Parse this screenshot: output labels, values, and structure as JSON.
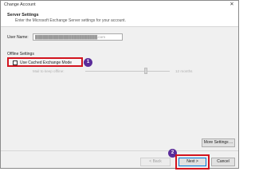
{
  "window": {
    "title": "Change Account",
    "close_glyph": "✕"
  },
  "header": {
    "title": "Server Settings",
    "subtitle": "Enter the Microsoft Exchange Server settings for your account."
  },
  "user": {
    "label": "User Name:",
    "value": "████████████████████████.com"
  },
  "offline": {
    "section_label": "Offline Settings",
    "cached_mode_label": "Use Cached Exchange Mode",
    "cached_mode_checked": false,
    "slider_label": "Mail to keep offline:",
    "slider_value": "12 months"
  },
  "buttons": {
    "more_settings": "More Settings ...",
    "back": "< Back",
    "next": "Next >",
    "cancel": "Cancel"
  },
  "annotations": {
    "step1": "1",
    "step2": "2"
  },
  "colors": {
    "highlight": "#d2141e",
    "badge": "#5b2c9a",
    "accent": "#0078d7"
  }
}
